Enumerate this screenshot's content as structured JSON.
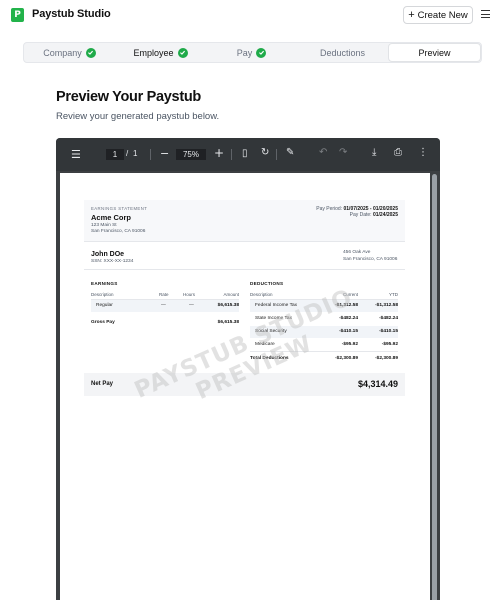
{
  "app": {
    "logo_letter": "P",
    "brand": "Paystub Studio",
    "create_label": "Create New"
  },
  "steps": [
    {
      "label": "Company",
      "done": true
    },
    {
      "label": "Employee",
      "done": true
    },
    {
      "label": "Pay",
      "done": true
    },
    {
      "label": "Deductions",
      "done": false
    },
    {
      "label": "Preview",
      "active": true
    }
  ],
  "main": {
    "title": "Preview Your Paystub",
    "subtitle": "Review your generated paystub below."
  },
  "viewer": {
    "page_current": "1",
    "page_total": "1",
    "zoom": "75%"
  },
  "stub": {
    "statement_label": "EARNINGS STATEMENT",
    "company": "Acme Corp",
    "company_addr1": "123 Main St",
    "company_addr2": "San Francisco, CA 91006",
    "pay_period_label": "Pay Period:",
    "pay_period": "01/07/2025 - 01/20/2025",
    "pay_date_label": "Pay Date:",
    "pay_date": "01/24/2025",
    "employee": "John DOe",
    "ssn": "SSN: XXX-XX-1234",
    "emp_addr1": "456 Oak Ave",
    "emp_addr2": "San Francisco, CA 91006",
    "earnings": {
      "title": "EARNINGS",
      "headers": [
        "Description",
        "Rate",
        "Hours",
        "Amount"
      ],
      "rows": [
        [
          "Regular",
          "—",
          "—",
          "$6,615.38"
        ]
      ],
      "gross_label": "Gross Pay",
      "gross_value": "$6,615.38"
    },
    "deductions": {
      "title": "DEDUCTIONS",
      "headers": [
        "Description",
        "Current",
        "YTD"
      ],
      "rows": [
        [
          "Federal Income Tax",
          "-$1,312.58",
          "-$1,312.58"
        ],
        [
          "State Income Tax",
          "-$482.24",
          "-$482.24"
        ],
        [
          "Social Security",
          "-$410.15",
          "-$410.15"
        ],
        [
          "Medicare",
          "-$95.92",
          "-$95.92"
        ]
      ],
      "total_label": "Total Deductions",
      "total_current": "-$2,300.89",
      "total_ytd": "-$2,300.89"
    },
    "net_label": "Net Pay",
    "net_value": "$4,314.49",
    "watermark_line1": "PAYSTUB STUDIO",
    "watermark_line2": "PREVIEW"
  },
  "colors": {
    "accent_green": "#1faa49",
    "viewer_dark": "#323639"
  }
}
